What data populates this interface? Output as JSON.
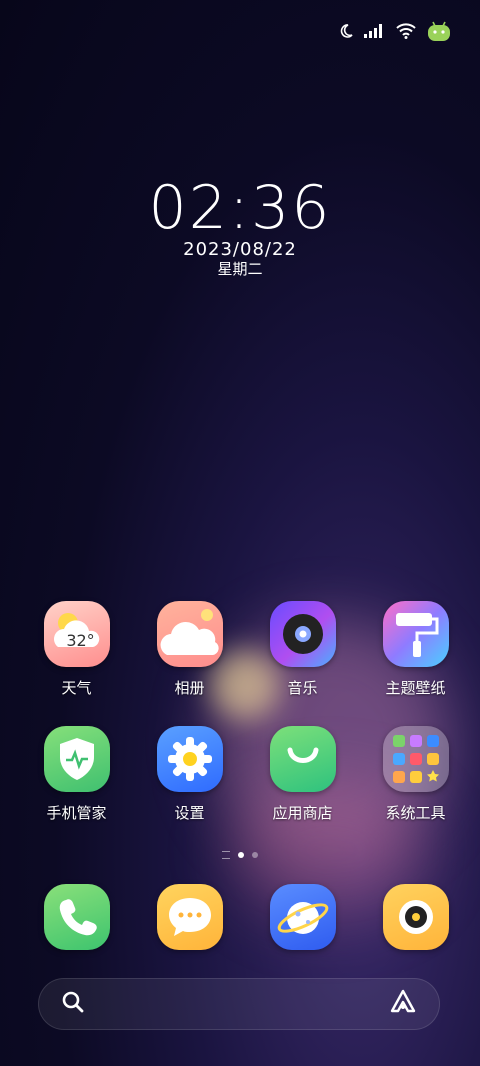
{
  "status_bar": {
    "icons": [
      "moon-icon",
      "signal-icon",
      "wifi-icon",
      "android-battery-icon"
    ]
  },
  "clock": {
    "time": "02:36",
    "date": "2023/08/22",
    "weekday": "星期二"
  },
  "apps": [
    {
      "name": "weather",
      "label": "天气",
      "badge": "32°",
      "icon": "weather-icon"
    },
    {
      "name": "gallery",
      "label": "相册",
      "icon": "cloud-icon"
    },
    {
      "name": "music",
      "label": "音乐",
      "icon": "music-disc-icon"
    },
    {
      "name": "themes",
      "label": "主题壁纸",
      "icon": "paint-roller-icon"
    },
    {
      "name": "security",
      "label": "手机管家",
      "icon": "shield-icon"
    },
    {
      "name": "settings",
      "label": "设置",
      "icon": "gear-icon"
    },
    {
      "name": "app-store",
      "label": "应用商店",
      "icon": "bag-smile-icon"
    },
    {
      "name": "system-tools",
      "label": "系统工具",
      "icon": "folder-grid-icon"
    }
  ],
  "page_indicator": {
    "pages": 2,
    "active": 1
  },
  "dock": [
    {
      "name": "phone",
      "icon": "phone-icon"
    },
    {
      "name": "messages",
      "icon": "chat-bubble-icon"
    },
    {
      "name": "browser",
      "icon": "planet-icon"
    },
    {
      "name": "camera",
      "icon": "camera-icon"
    }
  ],
  "search": {
    "left_icon": "search-icon",
    "right_icon": "assistant-a-icon"
  }
}
